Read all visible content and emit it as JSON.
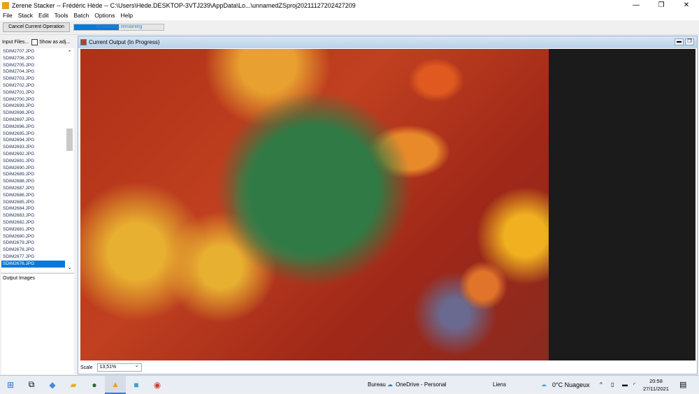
{
  "window": {
    "title": "Zerene Stacker -- Frédéric Hède -- C:\\Users\\Hède.DESKTOP-3VTJ239\\AppData\\Lo...\\unnamedZSproj20211127202427209",
    "controls": [
      "—",
      "❐",
      "✕"
    ]
  },
  "menu": [
    "File",
    "Stack",
    "Edit",
    "Tools",
    "Batch",
    "Options",
    "Help"
  ],
  "toolbar": {
    "cancel_label": "Cancel Current Operation",
    "progress_text": "40 minutes remaining",
    "progress_percent": 50
  },
  "input_files": {
    "header": "Input Files...",
    "show_as_label": "Show as adj...",
    "show_as_checked": false,
    "files": [
      "SDIM2707.JPG",
      "SDIM2706.JPG",
      "SDIM2705.JPG",
      "SDIM2704.JPG",
      "SDIM2703.JPG",
      "SDIM2702.JPG",
      "SDIM2701.JPG",
      "SDIM2700.JPG",
      "SDIM2699.JPG",
      "SDIM2698.JPG",
      "SDIM2697.JPG",
      "SDIM2696.JPG",
      "SDIM2695.JPG",
      "SDIM2694.JPG",
      "SDIM2693.JPG",
      "SDIM2692.JPG",
      "SDIM2691.JPG",
      "SDIM2690.JPG",
      "SDIM2689.JPG",
      "SDIM2688.JPG",
      "SDIM2687.JPG",
      "SDIM2686.JPG",
      "SDIM2685.JPG",
      "SDIM2684.JPG",
      "SDIM2683.JPG",
      "SDIM2682.JPG",
      "SDIM2681.JPG",
      "SDIM2680.JPG",
      "SDIM2679.JPG",
      "SDIM2678.JPG",
      "SDIM2677.JPG",
      "SDIM2676.JPG"
    ],
    "selected": "SDIM2676.JPG"
  },
  "output_images": {
    "header": "Output Images"
  },
  "panel": {
    "title": "Current Output (In Progress)",
    "scale_label": "Scale",
    "scale_value": "13,51%"
  },
  "taskbar": {
    "bureau": "Bureau",
    "onedrive": "OneDrive - Personal",
    "liens": "Liens",
    "weather": "0°C  Nuageux",
    "time": "20:58",
    "date": "27/11/2021"
  },
  "colors": {
    "accent": "#0a78d7"
  }
}
